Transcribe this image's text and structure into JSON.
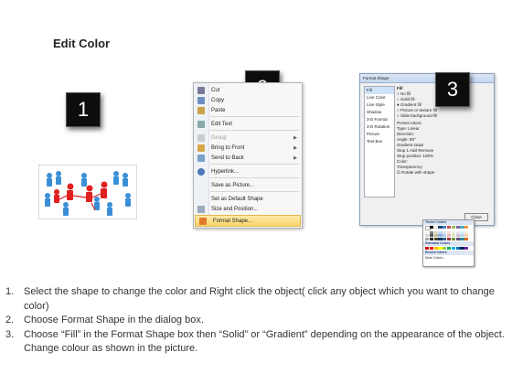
{
  "title": "Edit Color",
  "steps": [
    "1",
    "2",
    "3"
  ],
  "menu": {
    "items": [
      {
        "label": "Cut",
        "arrow": ""
      },
      {
        "label": "Copy",
        "arrow": ""
      },
      {
        "label": "Paste",
        "arrow": ""
      },
      {
        "label": "Edit Text",
        "arrow": ""
      },
      {
        "label": "Group",
        "arrow": "▶"
      },
      {
        "label": "Bring to Front",
        "arrow": "▶"
      },
      {
        "label": "Send to Back",
        "arrow": "▶"
      },
      {
        "label": "Hyperlink...",
        "arrow": ""
      },
      {
        "label": "Save as Picture...",
        "arrow": ""
      },
      {
        "label": "Set as Default Shape",
        "arrow": ""
      },
      {
        "label": "Size and Position...",
        "arrow": ""
      },
      {
        "label": "Format Shape...",
        "arrow": ""
      }
    ]
  },
  "dialog": {
    "title": "Format Shape",
    "nav": [
      "Fill",
      "Line Color",
      "Line Style",
      "Shadow",
      "3-D Format",
      "3-D Rotation",
      "Picture",
      "Text Box"
    ],
    "section": "Fill",
    "options": [
      "No fill",
      "Solid fill",
      "Gradient fill",
      "Picture or texture fill",
      "Slide background fill"
    ],
    "fields": [
      "Preset colors:",
      "Type:",
      "Direction:",
      "Angle:",
      "Gradient stops",
      "Stop position:",
      "Color:",
      "Transparency:",
      "Rotate with shape"
    ],
    "type_value": "Linear",
    "angle_value": "90°",
    "stop_value": "Stop 1",
    "stop_position_value": "100%",
    "add_label": "Add",
    "remove_label": "Remove",
    "close_label": "Close"
  },
  "palette": {
    "theme_label": "Theme Colors",
    "standard_label": "Standard Colors",
    "recent_label": "Recent Colors",
    "more_label": "More Colors..."
  },
  "instructions": [
    {
      "num": "1.",
      "text": "Select the shape to change the color and Right click the object( click any object which you want to change color)"
    },
    {
      "num": "2.",
      "text": "Choose Format Shape in the dialog box."
    },
    {
      "num": "3.",
      "text": "Choose “Fill” in the Format Shape box then “Solid” or “Gradient” depending on the appearance of the object. Change colour as shown in the picture."
    }
  ]
}
